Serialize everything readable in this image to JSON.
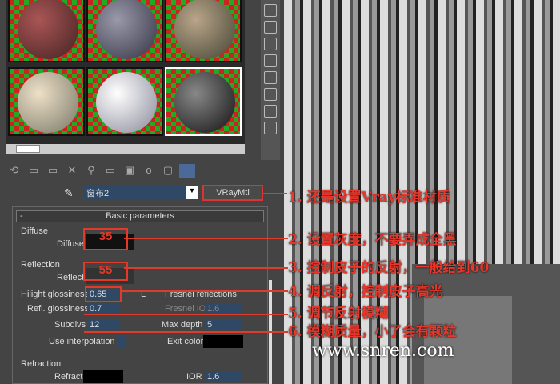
{
  "material": {
    "name": "窗布2",
    "type_button": "VRayMtl"
  },
  "rollout": {
    "title": "Basic parameters",
    "collapse": "-"
  },
  "diffuse": {
    "group": "Diffuse",
    "label": "Diffuse",
    "annotation_value": "35"
  },
  "reflection": {
    "group": "Reflection",
    "label": "Reflect",
    "annotation_value": "55",
    "hilight_label": "Hilight glossiness",
    "hilight_value": "0.65",
    "lock": "L",
    "fresnel_label": "Fresnel reflections",
    "refl_gloss_label": "Refl. glossiness",
    "refl_gloss_value": "0.7",
    "fresnel_ior_label": "Fresnel IOR",
    "fresnel_ior_value": "1.6",
    "subdivs_label": "Subdivs",
    "subdivs_value": "12",
    "maxdepth_label": "Max depth",
    "maxdepth_value": "5",
    "interp_label": "Use interpolation",
    "exit_label": "Exit color"
  },
  "refraction": {
    "group": "Refraction",
    "label": "Refract",
    "ior_label": "IOR",
    "ior_value": "1.6"
  },
  "annotations": [
    "1. 还是设置Vray标准材质",
    "2. 设置灰度，不要弄成全黑",
    "3. 控制皮子的反射，一般给到60",
    "4. 调反射，控制皮子高光",
    "5. 调节反射模糊",
    "6. 模糊质量，小了会有颗粒"
  ],
  "watermark": "www.snren.com",
  "colors": {
    "accent": "#e03a2a",
    "field": "#2f4866"
  }
}
